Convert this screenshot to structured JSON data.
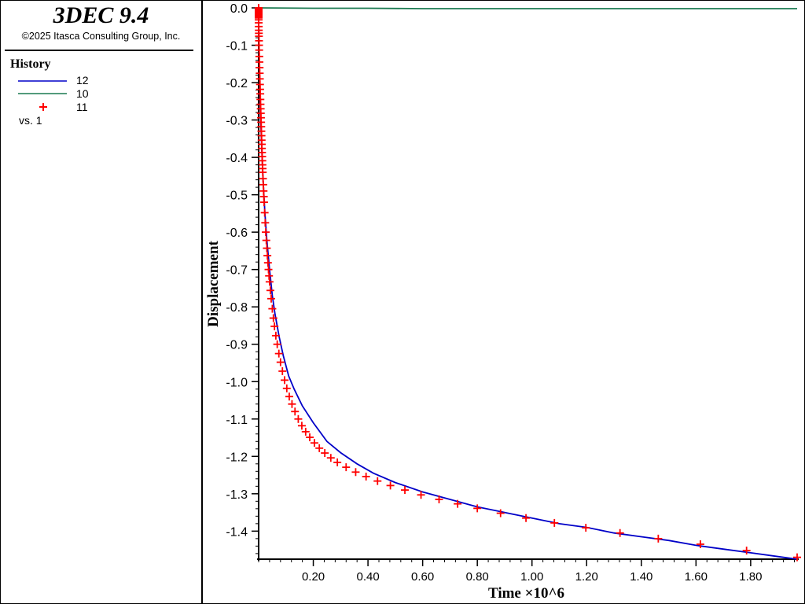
{
  "app": {
    "title": "3DEC 9.4",
    "copyright": "©2025 Itasca Consulting Group, Inc."
  },
  "legend": {
    "heading": "History",
    "entries": [
      {
        "label": "12",
        "color": "#0000c8",
        "style": "line"
      },
      {
        "label": "10",
        "color": "#1a7a50",
        "style": "line"
      },
      {
        "label": "11",
        "color": "#ff0000",
        "style": "plus-marker"
      }
    ],
    "vs_label": "vs. 1"
  },
  "chart_data": {
    "type": "line",
    "xlabel": "Time ×10^6",
    "ylabel": "Displacement",
    "xlim": [
      0.0,
      1.97
    ],
    "ylim": [
      -1.475,
      0.0
    ],
    "x_ticks": [
      0.2,
      0.4,
      0.6,
      0.8,
      1.0,
      1.2,
      1.4,
      1.6,
      1.8
    ],
    "x_tick_labels": [
      "0.20",
      "0.40",
      "0.60",
      "0.80",
      "1.00",
      "1.20",
      "1.40",
      "1.60",
      "1.80"
    ],
    "y_ticks": [
      0.0,
      -0.1,
      -0.2,
      -0.3,
      -0.4,
      -0.5,
      -0.6,
      -0.7,
      -0.8,
      -0.9,
      -1.0,
      -1.1,
      -1.2,
      -1.3,
      -1.4
    ],
    "y_tick_labels": [
      "0.0",
      "-0.1",
      "-0.2",
      "-0.3",
      "-0.4",
      "-0.5",
      "-0.6",
      "-0.7",
      "-0.8",
      "-0.9",
      "-1.0",
      "-1.1",
      "-1.2",
      "-1.3",
      "-1.4"
    ],
    "grid": false,
    "series": [
      {
        "name": "12",
        "color": "#0000c8",
        "style": "line",
        "x": [
          0.0,
          0.0001,
          0.001,
          0.003,
          0.005,
          0.008,
          0.012,
          0.017,
          0.023,
          0.03,
          0.04,
          0.05,
          0.06,
          0.075,
          0.09,
          0.11,
          0.13,
          0.16,
          0.2,
          0.25,
          0.3,
          0.36,
          0.42,
          0.5,
          0.6,
          0.7,
          0.8,
          0.9,
          1.0,
          1.1,
          1.2,
          1.3,
          1.4,
          1.5,
          1.6,
          1.7,
          1.8,
          1.9,
          1.97
        ],
        "y": [
          0.0,
          -0.02,
          -0.08,
          -0.16,
          -0.23,
          -0.31,
          -0.39,
          -0.47,
          -0.55,
          -0.62,
          -0.7,
          -0.77,
          -0.82,
          -0.88,
          -0.93,
          -0.985,
          -1.02,
          -1.065,
          -1.11,
          -1.16,
          -1.19,
          -1.22,
          -1.245,
          -1.27,
          -1.295,
          -1.315,
          -1.335,
          -1.35,
          -1.365,
          -1.38,
          -1.39,
          -1.405,
          -1.415,
          -1.425,
          -1.438,
          -1.448,
          -1.458,
          -1.468,
          -1.475
        ]
      },
      {
        "name": "10",
        "color": "#1a7a50",
        "style": "line",
        "x": [
          0.0,
          0.2,
          0.4,
          0.6,
          0.8,
          1.0,
          1.2,
          1.4,
          1.6,
          1.8,
          1.97
        ],
        "y": [
          0.0,
          -0.001,
          -0.001,
          -0.002,
          -0.002,
          -0.002,
          -0.002,
          -0.002,
          -0.002,
          -0.002,
          -0.002
        ]
      },
      {
        "name": "11",
        "color": "#ff0000",
        "style": "plus-marker",
        "x": [
          0.0,
          0.0,
          0.0,
          0.0,
          0.0,
          0.0,
          0.0,
          0.0,
          0.0,
          0.0,
          0.0001,
          0.0002,
          0.0004,
          0.0006,
          0.0008,
          0.001,
          0.0013,
          0.0016,
          0.002,
          0.0025,
          0.003,
          0.0035,
          0.004,
          0.0045,
          0.005,
          0.0055,
          0.006,
          0.0065,
          0.007,
          0.0075,
          0.008,
          0.0085,
          0.009,
          0.0095,
          0.01,
          0.0105,
          0.011,
          0.0115,
          0.012,
          0.0125,
          0.013,
          0.0135,
          0.014,
          0.0145,
          0.015,
          0.016,
          0.017,
          0.018,
          0.019,
          0.02,
          0.022,
          0.024,
          0.026,
          0.028,
          0.03,
          0.032,
          0.034,
          0.036,
          0.038,
          0.04,
          0.043,
          0.046,
          0.05,
          0.054,
          0.058,
          0.063,
          0.068,
          0.074,
          0.08,
          0.087,
          0.095,
          0.103,
          0.112,
          0.122,
          0.133,
          0.145,
          0.158,
          0.172,
          0.187,
          0.204,
          0.222,
          0.242,
          0.264,
          0.288,
          0.32,
          0.355,
          0.393,
          0.435,
          0.482,
          0.535,
          0.594,
          0.66,
          0.728,
          0.8,
          0.885,
          0.978,
          1.082,
          1.197,
          1.322,
          1.462,
          1.616,
          1.785,
          1.97
        ],
        "y": [
          0.0,
          -0.003,
          -0.006,
          -0.009,
          -0.012,
          -0.015,
          -0.018,
          -0.021,
          -0.024,
          -0.027,
          -0.032,
          -0.04,
          -0.05,
          -0.06,
          -0.068,
          -0.076,
          -0.088,
          -0.1,
          -0.113,
          -0.13,
          -0.145,
          -0.16,
          -0.175,
          -0.19,
          -0.205,
          -0.218,
          -0.23,
          -0.245,
          -0.258,
          -0.27,
          -0.282,
          -0.294,
          -0.306,
          -0.318,
          -0.33,
          -0.342,
          -0.354,
          -0.365,
          -0.376,
          -0.387,
          -0.398,
          -0.409,
          -0.42,
          -0.43,
          -0.44,
          -0.457,
          -0.473,
          -0.49,
          -0.505,
          -0.52,
          -0.548,
          -0.575,
          -0.6,
          -0.622,
          -0.643,
          -0.663,
          -0.682,
          -0.7,
          -0.717,
          -0.733,
          -0.756,
          -0.778,
          -0.805,
          -0.83,
          -0.852,
          -0.877,
          -0.9,
          -0.925,
          -0.948,
          -0.972,
          -0.996,
          -1.018,
          -1.04,
          -1.06,
          -1.08,
          -1.1,
          -1.118,
          -1.134,
          -1.149,
          -1.164,
          -1.178,
          -1.191,
          -1.204,
          -1.216,
          -1.229,
          -1.242,
          -1.254,
          -1.266,
          -1.278,
          -1.29,
          -1.303,
          -1.315,
          -1.327,
          -1.339,
          -1.352,
          -1.365,
          -1.378,
          -1.391,
          -1.405,
          -1.42,
          -1.435,
          -1.452,
          -1.47
        ]
      }
    ]
  }
}
